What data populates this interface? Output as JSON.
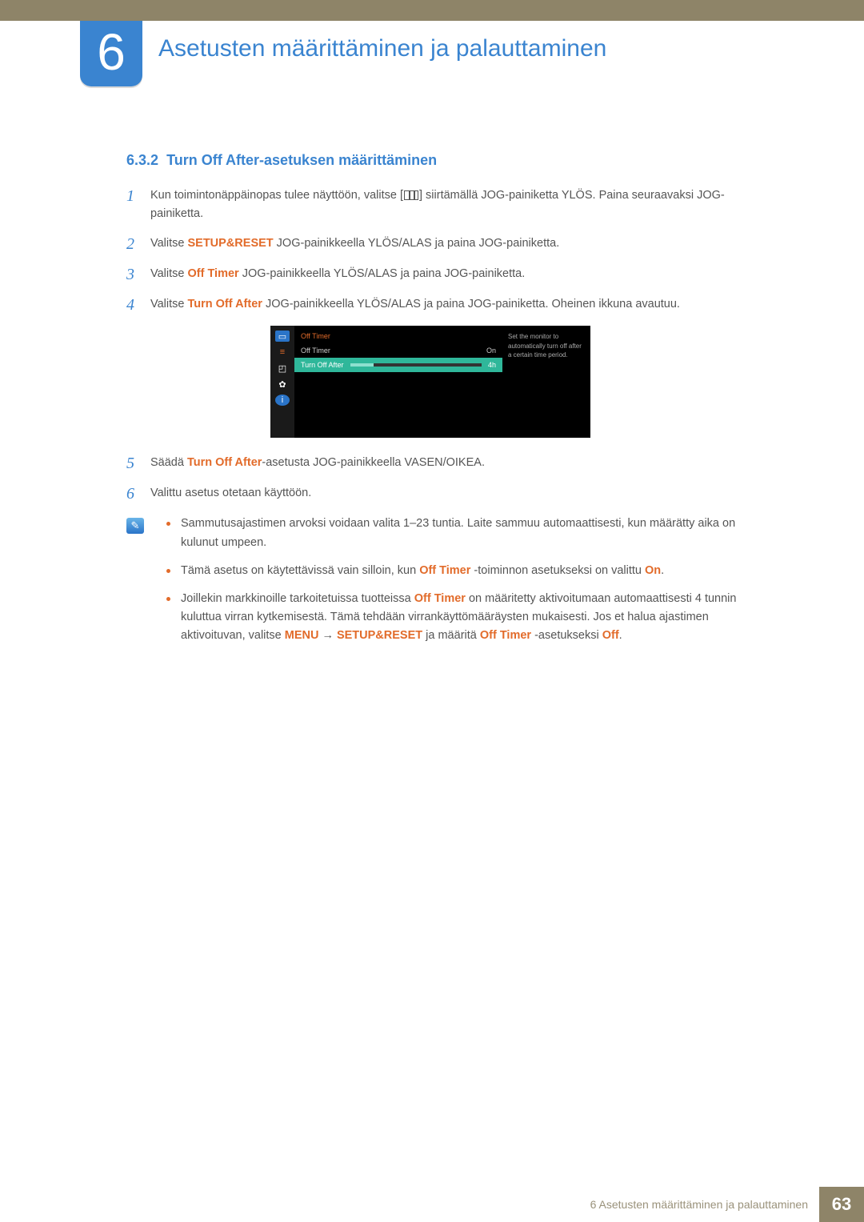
{
  "chapter": {
    "number": "6",
    "title": "Asetusten määrittäminen ja palauttaminen"
  },
  "section": {
    "number": "6.3.2",
    "title": "Turn Off After-asetuksen määrittäminen"
  },
  "steps": {
    "s1_a": "Kun toimintonäppäinopas tulee näyttöön, valitse [",
    "s1_b": "] siirtämällä JOG-painiketta YLÖS. Paina seuraavaksi JOG-painiketta.",
    "s2_a": "Valitse ",
    "s2_hl": "SETUP&RESET",
    "s2_b": " JOG-painikkeella YLÖS/ALAS ja paina JOG-painiketta.",
    "s3_a": "Valitse ",
    "s3_hl": "Off Timer",
    "s3_b": " JOG-painikkeella YLÖS/ALAS ja paina JOG-painiketta.",
    "s4_a": "Valitse ",
    "s4_hl": "Turn Off After",
    "s4_b": " JOG-painikkeella YLÖS/ALAS ja paina JOG-painiketta. Oheinen ikkuna avautuu.",
    "s5_a": "Säädä ",
    "s5_hl": "Turn Off After",
    "s5_b": "-asetusta JOG-painikkeella VASEN/OIKEA.",
    "s6": "Valittu asetus otetaan käyttöön."
  },
  "osd": {
    "menu_title": "Off Timer",
    "row1_label": "Off Timer",
    "row1_value": "On",
    "row2_label": "Turn Off After",
    "row2_value": "4h",
    "desc": "Set the monitor to automatically turn off after a certain time period."
  },
  "notes": {
    "n1": "Sammutusajastimen arvoksi voidaan valita 1–23 tuntia. Laite sammuu automaattisesti, kun määrätty aika on kulunut umpeen.",
    "n2_a": "Tämä asetus on käytettävissä vain silloin, kun ",
    "n2_hl1": "Off Timer",
    "n2_b": " -toiminnon asetukseksi on valittu ",
    "n2_hl2": "On",
    "n2_c": ".",
    "n3_a": "Joillekin markkinoille tarkoitetuissa tuotteissa ",
    "n3_hl1": "Off Timer",
    "n3_b": " on määritetty aktivoitumaan automaattisesti 4 tunnin kuluttua virran kytkemisestä. Tämä tehdään virrankäyttömääräysten mukaisesti. Jos et halua ajastimen aktivoituvan, valitse ",
    "n3_hl2": "MENU",
    "n3_arrow": "→",
    "n3_hl3": "SETUP&RESET",
    "n3_c": " ja määritä ",
    "n3_hl4": "Off Timer",
    "n3_d": " -asetukseksi ",
    "n3_hl5": "Off",
    "n3_e": "."
  },
  "footer": {
    "text": "6 Asetusten määrittäminen ja palauttaminen",
    "page": "63"
  }
}
